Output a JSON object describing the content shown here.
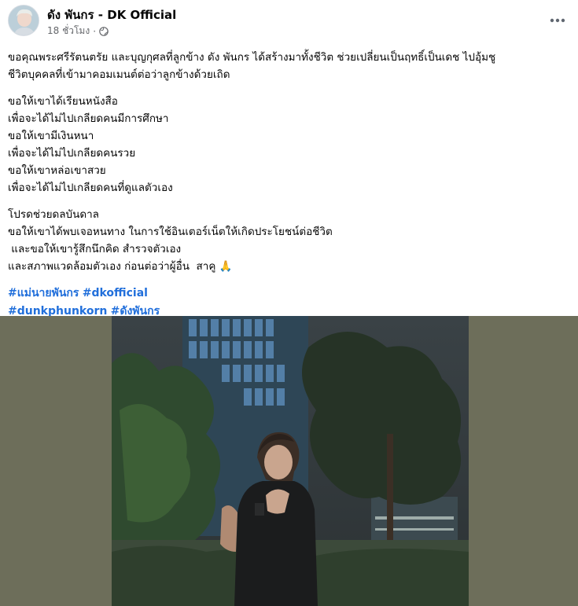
{
  "post": {
    "author": "ดัง พันกร - DK Official",
    "timestamp": "18 ชั่วโมง",
    "privacy_icon": "globe-icon",
    "menu_icon": "more-icon",
    "paragraphs": [
      [
        "ขอคุณพระศรีรัตนตรัย และบุญกุศลที่ลูกข้าง ดัง พันกร ได้สร้างมาทั้งชีวิต ช่วยเปลี่ยนเป็นฤทธิ์เป็นเดช ไปอุ้มชู",
        "ชีวิตบุคคลที่เข้ามาคอมเมนต์ต่อว่าลูกข้างด้วยเถิด"
      ],
      [
        "ขอให้เขาได้เรียนหนังสือ",
        "เพื่อจะได้ไม่ไปเกลียดคนมีการศึกษา",
        "ขอให้เขามีเงินหนา",
        "เพื่อจะได้ไม่ไปเกลียดคนรวย",
        "ขอให้เขาหล่อเขาสวย",
        "เพื่อจะได้ไม่ไปเกลียดคนที่ดูแลตัวเอง"
      ],
      [
        "โปรดช่วยดลบันดาล",
        "ขอให้เขาได้พบเจอหนทาง ในการใช้อินเตอร์เน็ตให้เกิดประโยชน์ต่อชีวิต",
        " และขอให้เขารู้สึกนึกคิด สำรวจตัวเอง",
        "และสภาพแวดล้อมตัวเอง ก่อนต่อว่าผู้อื่น  สาคู 🙏"
      ]
    ],
    "hashtags": [
      [
        "#แม่นายพันกร",
        "#dkofficial"
      ],
      [
        "#dunkphunkorn",
        "#ดังพันกร"
      ]
    ],
    "photo_alt": "Man in black t-shirt with hands pressed together in prayer, standing among trees at night in front of a lit office building"
  },
  "colors": {
    "hashtag": "#216fdb",
    "secondary_text": "#65676b",
    "photo_backdrop": "#6d6e5a"
  }
}
